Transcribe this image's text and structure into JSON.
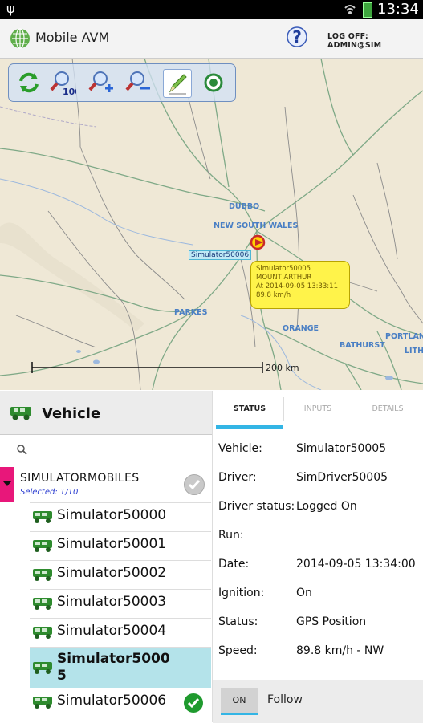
{
  "status_bar": {
    "time": "13:34",
    "usb_icon": "usb-icon",
    "wifi_icon": "wifi-icon",
    "battery_icon": "battery-icon"
  },
  "app_bar": {
    "title": "Mobile AVM",
    "logoff": "LOG OFF: ADMIN@SIM",
    "help_icon": "help-icon"
  },
  "map": {
    "toolbar": [
      {
        "name": "refresh-icon"
      },
      {
        "name": "zoom-100-icon",
        "label": "100"
      },
      {
        "name": "zoom-in-icon"
      },
      {
        "name": "zoom-out-icon"
      },
      {
        "name": "draw-icon"
      },
      {
        "name": "locate-icon"
      }
    ],
    "labels": [
      "DUBBO",
      "NEW SOUTH WALES",
      "PARKES",
      "ORANGE",
      "BATHURST",
      "PORTLAN",
      "LITH"
    ],
    "vehicle_label": "Simulator50006",
    "callout": {
      "vehicle": "Simulator50005",
      "place": "MOUNT ARTHUR",
      "at": "At 2014-09-05 13:33:11",
      "speed": "89.8 km/h"
    },
    "scale": "200 km"
  },
  "vehicle_panel": {
    "title": "Vehicle",
    "search_placeholder": "",
    "group": {
      "name": "SIMULATORMOBILES",
      "selected": "Selected: 1/10"
    },
    "vehicles": [
      {
        "name": "Simulator50000",
        "selected": false,
        "checked": false
      },
      {
        "name": "Simulator50001",
        "selected": false,
        "checked": false
      },
      {
        "name": "Simulator50002",
        "selected": false,
        "checked": false
      },
      {
        "name": "Simulator50003",
        "selected": false,
        "checked": false
      },
      {
        "name": "Simulator50004",
        "selected": false,
        "checked": false
      },
      {
        "name": "Simulator5000\n5",
        "selected": true,
        "checked": false
      },
      {
        "name": "Simulator50006",
        "selected": false,
        "checked": true
      }
    ]
  },
  "details_panel": {
    "tabs": [
      "STATUS",
      "INPUTS",
      "DETAILS"
    ],
    "rows": [
      {
        "label": "Vehicle:",
        "value": "Simulator50005"
      },
      {
        "label": "Driver:",
        "value": "SimDriver50005"
      },
      {
        "label": "Driver status:",
        "value": "Logged On"
      },
      {
        "label": "Run:",
        "value": ""
      },
      {
        "label": "Date:",
        "value": "2014-09-05 13:34:00"
      },
      {
        "label": "Ignition:",
        "value": "On"
      },
      {
        "label": "Status:",
        "value": "GPS Position"
      },
      {
        "label": "Speed:",
        "value": "89.8 km/h - NW"
      }
    ],
    "follow": {
      "toggle": "ON",
      "label": "Follow"
    }
  },
  "colors": {
    "accent": "#33b5e5",
    "callout": "#fff34a",
    "selected_row": "#b4e3ea",
    "group_marker": "#e8177a"
  }
}
